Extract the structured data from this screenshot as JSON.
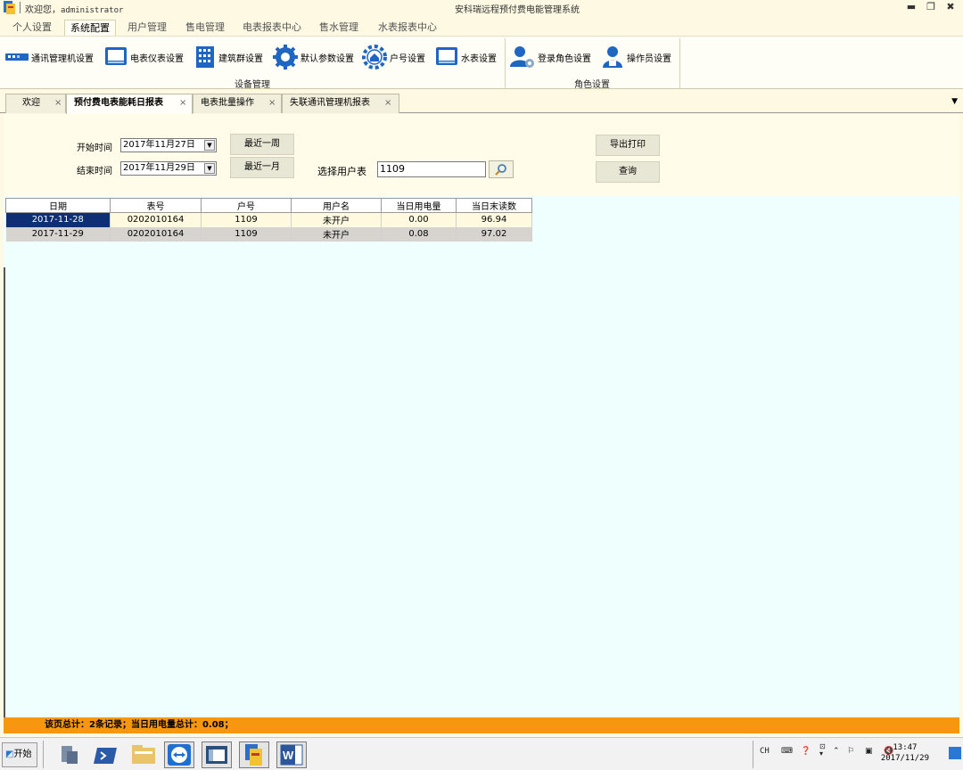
{
  "titlebar": {
    "welcome_prefix": "欢迎您，",
    "user": "administrator",
    "app_title": "安科瑞远程预付费电能管理系统",
    "minimize": "▬",
    "restore": "❐",
    "close": "✖"
  },
  "menu": {
    "items": [
      "个人设置",
      "系统配置",
      "用户管理",
      "售电管理",
      "电表报表中心",
      "售水管理",
      "水表报表中心"
    ],
    "active": "系统配置"
  },
  "ribbon": {
    "buttons": {
      "comm": "通讯管理机设置",
      "meter": "电表仪表设置",
      "building": "建筑群设置",
      "params": "默认参数设置",
      "household": "户号设置",
      "water": "水表设置",
      "login_role": "登录角色设置",
      "operator": "操作员设置"
    },
    "groups": {
      "device": "设备管理",
      "role": "角色设置"
    }
  },
  "tabs": [
    {
      "label": "欢迎",
      "close": "×"
    },
    {
      "label": "预付费电表能耗日报表",
      "close": "×"
    },
    {
      "label": "电表批量操作",
      "close": "×"
    },
    {
      "label": "失联通讯管理机报表",
      "close": "×"
    }
  ],
  "filter": {
    "start_label": "开始时间",
    "start_value": "2017年11月27日",
    "end_label": "结束时间",
    "end_value": "2017年11月29日",
    "last_week": "最近一周",
    "last_month": "最近一月",
    "select_user_label": "选择用户表",
    "user_value": "1109",
    "export_print": "导出打印",
    "query": "查询"
  },
  "grid": {
    "columns": [
      "日期",
      "表号",
      "户号",
      "用户名",
      "当日用电量",
      "当日末读数"
    ],
    "rows": [
      [
        "2017-11-28",
        "0202010164",
        "1109",
        "未开户",
        "0.00",
        "96.94"
      ],
      [
        "2017-11-29",
        "0202010164",
        "1109",
        "未开户",
        "0.08",
        "97.02"
      ]
    ]
  },
  "summary": "该页总计：2条记录；当日用电量总计：0.08；",
  "taskbar": {
    "start": "开始",
    "lang": "CH",
    "time": "13:47",
    "date": "2017/11/29"
  },
  "colors": {
    "selected_row": "#0e2f74",
    "summary_bar": "#f7970f",
    "grid_bg": "#eefffe"
  }
}
